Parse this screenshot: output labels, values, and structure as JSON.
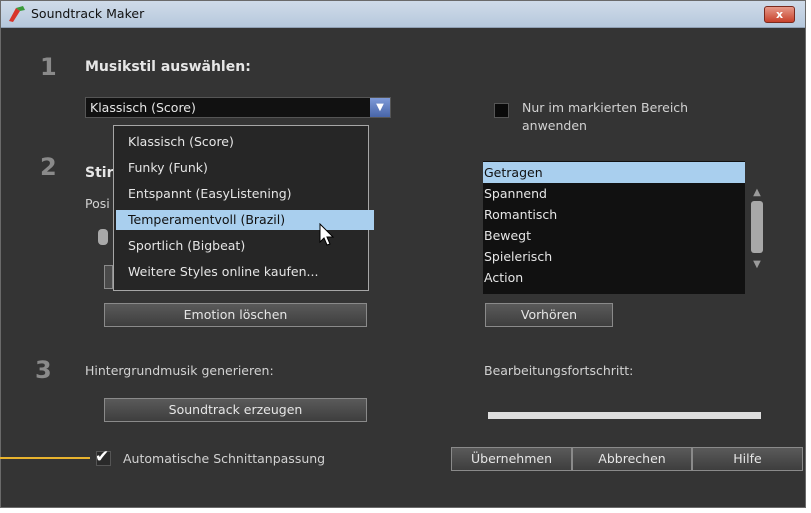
{
  "window": {
    "title": "Soundtrack Maker",
    "close_label": "x"
  },
  "section1": {
    "number": "1",
    "heading": "Musikstil auswählen:",
    "style_select": {
      "value": "Klassisch (Score)",
      "options": [
        "Klassisch (Score)",
        "Funky (Funk)",
        "Entspannt (EasyListening)",
        "Temperamentvoll (Brazil)",
        "Sportlich (Bigbeat)",
        "Weitere Styles online kaufen..."
      ],
      "highlighted_index": 3
    },
    "range_checkbox": {
      "label_line1": "Nur im markierten Bereich",
      "label_line2": "anwenden",
      "checked": false
    }
  },
  "section2": {
    "number": "2",
    "heading_partial": "Stir",
    "position_partial": "Posi",
    "emotions": [
      "Getragen",
      "Spannend",
      "Romantisch",
      "Bewegt",
      "Spielerisch",
      "Action"
    ],
    "selected_emotion_index": 0,
    "delete_emotion_button": "Emotion löschen",
    "preview_button": "Vorhören"
  },
  "section3": {
    "number": "3",
    "generate_label": "Hintergrundmusik generieren:",
    "generate_button": "Soundtrack erzeugen",
    "progress_label": "Bearbeitungsfortschritt:",
    "progress_fraction": 0
  },
  "footer": {
    "auto_fit_label": "Automatische Schnittanpassung",
    "auto_fit_checked": true,
    "apply_button": "Übernehmen",
    "cancel_button": "Abbrechen",
    "help_button": "Hilfe"
  },
  "colors": {
    "window_bg": "#343434",
    "selection": "#a9cfee",
    "accent_blue": "#4865a8",
    "close_red": "#c8412b",
    "callout": "#e8b32e"
  }
}
